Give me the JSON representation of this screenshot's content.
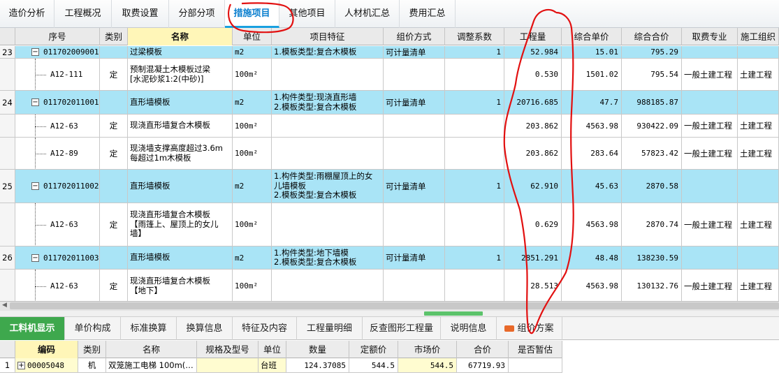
{
  "top_tabs": [
    {
      "label": "造价分析",
      "active": false
    },
    {
      "label": "工程概况",
      "active": false
    },
    {
      "label": "取费设置",
      "active": false
    },
    {
      "label": "分部分项",
      "active": false
    },
    {
      "label": "措施项目",
      "active": true
    },
    {
      "label": "其他项目",
      "active": false
    },
    {
      "label": "人材机汇总",
      "active": false
    },
    {
      "label": "费用汇总",
      "active": false
    }
  ],
  "table": {
    "headers": [
      "序号",
      "类别",
      "名称",
      "单位",
      "项目特征",
      "组价方式",
      "调整系数",
      "工程量",
      "综合单价",
      "综合合价",
      "取费专业",
      "施工组织"
    ],
    "rows": [
      {
        "kind": "parent",
        "num": "23",
        "code": "011702009001",
        "type": "",
        "name": "过梁模板",
        "unit": "m2",
        "feature": "1.模板类型:复合木模板",
        "method": "可计量清单",
        "coef": "1",
        "qty": "52.984",
        "price": "15.01",
        "total": "795.29",
        "fee": "",
        "org": ""
      },
      {
        "kind": "child",
        "num": "",
        "code": "A12-111",
        "type": "定",
        "name": "预制混凝土木模板过梁\n[水泥砂浆1:2(中砂)]",
        "unit": "100m²",
        "feature": "",
        "method": "",
        "coef": "",
        "qty": "0.530",
        "price": "1501.02",
        "total": "795.54",
        "fee": "一般土建工程",
        "org": "土建工程"
      },
      {
        "kind": "parent",
        "num": "24",
        "code": "011702011001",
        "type": "",
        "name": "直形墙模板",
        "unit": "m2",
        "feature": "1.构件类型:现浇直形墙\n2.模板类型:复合木模板",
        "method": "可计量清单",
        "coef": "1",
        "qty": "20716.685",
        "price": "47.7",
        "total": "988185.87",
        "fee": "",
        "org": ""
      },
      {
        "kind": "child",
        "num": "",
        "code": "A12-63",
        "type": "定",
        "name": "现浇直形墙复合木模板",
        "unit": "100m²",
        "feature": "",
        "method": "",
        "coef": "",
        "qty": "203.862",
        "price": "4563.98",
        "total": "930422.09",
        "fee": "一般土建工程",
        "org": "土建工程"
      },
      {
        "kind": "child",
        "num": "",
        "code": "A12-89",
        "type": "定",
        "name": "现浇墙支撑高度超过3.6m\n每超过1m木模板",
        "unit": "100m²",
        "feature": "",
        "method": "",
        "coef": "",
        "qty": "203.862",
        "price": "283.64",
        "total": "57823.42",
        "fee": "一般土建工程",
        "org": "土建工程"
      },
      {
        "kind": "parent",
        "num": "25",
        "code": "011702011002",
        "type": "",
        "name": "直形墙模板",
        "unit": "m2",
        "feature": "1.构件类型:雨棚屋顶上的女\n儿墙模板\n2.模板类型:复合木模板",
        "method": "可计量清单",
        "coef": "1",
        "qty": "62.910",
        "price": "45.63",
        "total": "2870.58",
        "fee": "",
        "org": ""
      },
      {
        "kind": "child",
        "num": "",
        "code": "A12-63",
        "type": "定",
        "name": "现浇直形墙复合木模板\n【雨篷上、屋顶上的女儿\n墙】",
        "unit": "100m²",
        "feature": "",
        "method": "",
        "coef": "",
        "qty": "0.629",
        "price": "4563.98",
        "total": "2870.74",
        "fee": "一般土建工程",
        "org": "土建工程"
      },
      {
        "kind": "parent",
        "num": "26",
        "code": "011702011003",
        "type": "",
        "name": "直形墙模板",
        "unit": "m2",
        "feature": "1.构件类型:地下墙模\n2.模板类型:复合木模板",
        "method": "可计量清单",
        "coef": "1",
        "qty": "2851.291",
        "price": "48.48",
        "total": "138230.59",
        "fee": "",
        "org": ""
      },
      {
        "kind": "child",
        "num": "",
        "code": "A12-63",
        "type": "定",
        "name": "现浇直形墙复合木模板\n【地下】",
        "unit": "100m²",
        "feature": "",
        "method": "",
        "coef": "",
        "qty": "28.513",
        "price": "4563.98",
        "total": "130132.76",
        "fee": "一般土建工程",
        "org": "土建工程"
      }
    ]
  },
  "bottom_tabs": [
    {
      "label": "工料机显示",
      "active": true
    },
    {
      "label": "单价构成",
      "active": false
    },
    {
      "label": "标准换算",
      "active": false
    },
    {
      "label": "换算信息",
      "active": false
    },
    {
      "label": "特征及内容",
      "active": false
    },
    {
      "label": "工程量明细",
      "active": false
    },
    {
      "label": "反查图形工程量",
      "active": false
    },
    {
      "label": "说明信息",
      "active": false
    },
    {
      "label": "组价方案",
      "active": false
    }
  ],
  "detail": {
    "headers": [
      "编码",
      "类别",
      "名称",
      "规格及型号",
      "单位",
      "数量",
      "定额价",
      "市场价",
      "合价",
      "是否暂估"
    ],
    "row": {
      "num": "1",
      "code": "00005048",
      "type": "机",
      "name": "双笼施工电梯 100m(…",
      "spec": "",
      "unit": "台班",
      "qty": "124.37085",
      "base": "544.5",
      "market": "544.5",
      "total": "67719.93",
      "est": ""
    }
  },
  "colors": {
    "blue_row": "#a9e4f6",
    "active_tab": "#0a7fcf",
    "bottom_active": "#3ea84d",
    "annotation": "#e21010"
  }
}
